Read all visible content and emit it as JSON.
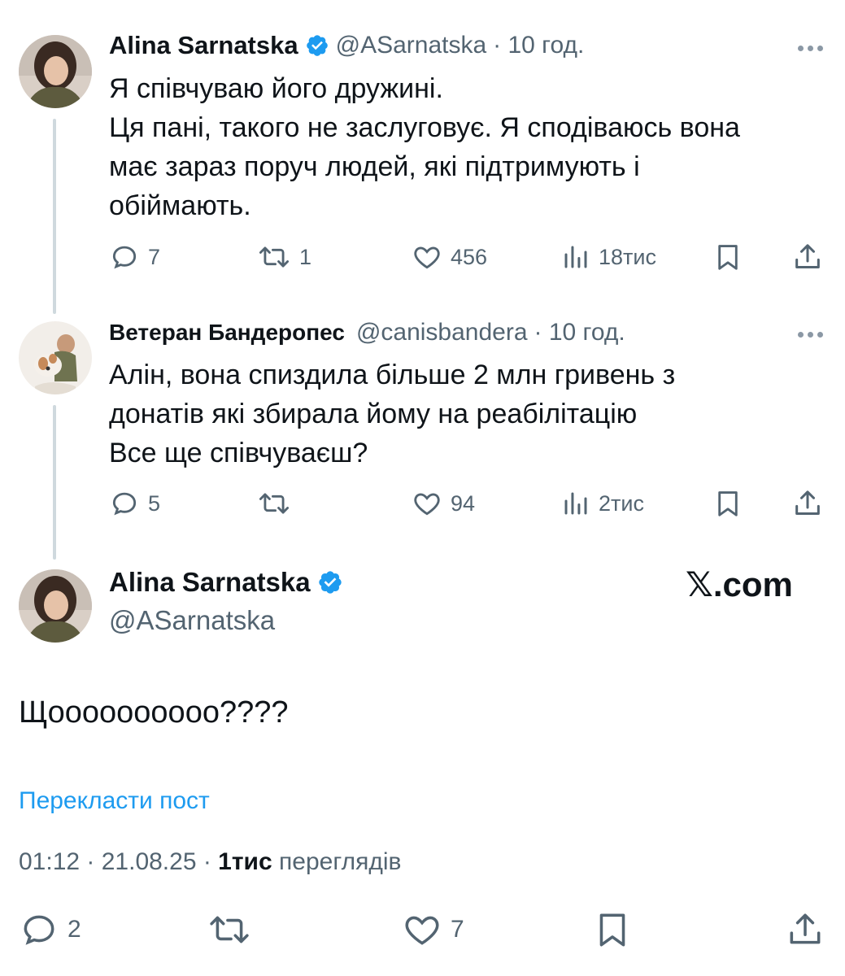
{
  "tweet1": {
    "name": "Alina Sarnatska",
    "handle": "@ASarnatska",
    "time": "· 10 год.",
    "lines": [
      "Я співчуваю його дружині.",
      "Ця пані, такого не заслуговує. Я сподіваюсь вона",
      "має зараз поруч людей, які підтримують і",
      "обіймають."
    ],
    "replies": "7",
    "retweets": "1",
    "likes": "456",
    "views": "18тис"
  },
  "tweet2": {
    "name": "Ветеран Бандеропес",
    "handle": "@canisbandera",
    "time": "· 10 год.",
    "lines": [
      "Алін, вона спиздила більше 2 млн гривень з",
      "донатів які збирала йому на реабілітацію",
      "Все ще співчуваєш?"
    ],
    "replies": "5",
    "retweets": "",
    "likes": "94",
    "views": "2тис"
  },
  "main": {
    "name": "Alina Sarnatska",
    "handle": "@ASarnatska",
    "watermark": "𝕏.com",
    "text": "Щоооооооооо????",
    "translate": "Перекласти пост",
    "timestamp": "01:12 · 21.08.25 · ",
    "views_count": "1тис",
    "views_label": " переглядів",
    "replies": "2",
    "retweets": "",
    "likes": "7"
  },
  "colors": {
    "verified": "#1d9bf0",
    "link": "#1d9bf0",
    "muted": "#536471",
    "thread_line": "#cfd9de"
  },
  "icons": [
    "verified-badge-icon",
    "more-icon",
    "reply-icon",
    "retweet-icon",
    "like-icon",
    "views-icon",
    "bookmark-icon",
    "share-icon"
  ]
}
